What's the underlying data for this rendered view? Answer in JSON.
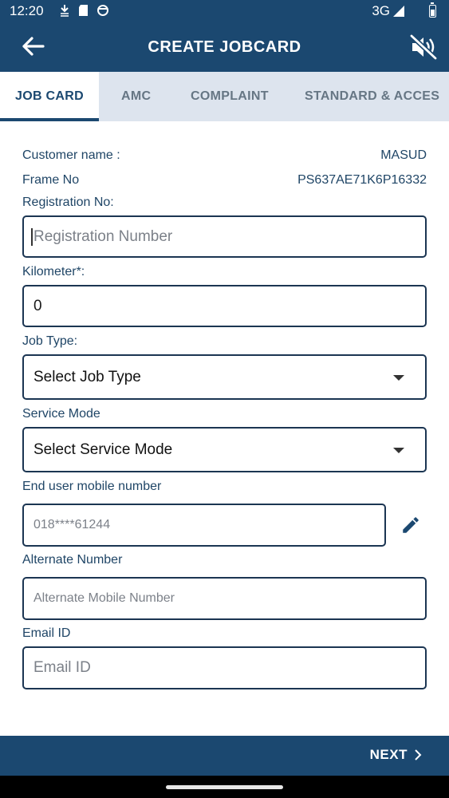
{
  "status_bar": {
    "time": "12:20",
    "network": "3G"
  },
  "app_bar": {
    "title": "CREATE JOBCARD",
    "back_icon": "arrow-left-icon",
    "mute_icon": "volume-off-icon"
  },
  "tabs": [
    {
      "label": "JOB CARD",
      "active": true
    },
    {
      "label": "AMC",
      "active": false
    },
    {
      "label": "COMPLAINT",
      "active": false
    },
    {
      "label": "STANDARD & ACCES",
      "active": false
    }
  ],
  "info": {
    "customer_name_label": "Customer name :",
    "customer_name_value": "MASUD",
    "frame_no_label": "Frame No",
    "frame_no_value": "PS637AE71K6P16332"
  },
  "form": {
    "registration": {
      "label": "Registration No:",
      "placeholder": "Registration Number"
    },
    "kilometer": {
      "label": "Kilometer*:",
      "value": "0"
    },
    "job_type": {
      "label": "Job Type:",
      "selected": "Select Job Type"
    },
    "service_mode": {
      "label": "Service Mode",
      "selected": "Select Service Mode"
    },
    "end_user_mobile": {
      "label": "End user mobile number",
      "value": "018****61244"
    },
    "alternate_number": {
      "label": "Alternate Number",
      "placeholder": "Alternate Mobile Number"
    },
    "email": {
      "label": "Email ID",
      "placeholder": "Email ID"
    }
  },
  "footer": {
    "next_label": "NEXT"
  },
  "colors": {
    "primary": "#1b4870",
    "tab_bar_bg": "#dde4ee",
    "label_text": "#1f4566"
  }
}
